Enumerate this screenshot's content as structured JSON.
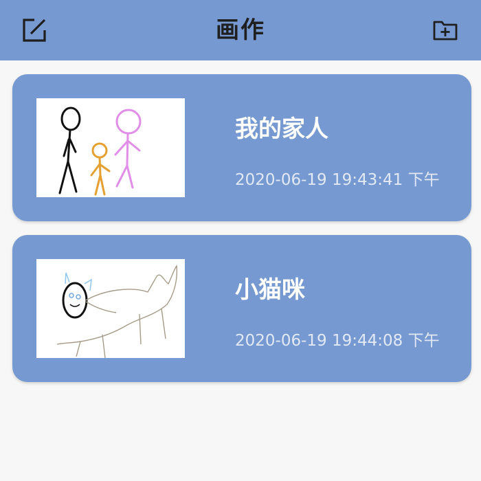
{
  "header": {
    "title": "画作",
    "left_icon": "edit-icon",
    "right_icon": "add-folder-icon"
  },
  "drawings": [
    {
      "title": "我的家人",
      "timestamp": "2020-06-19 19:43:41 下午",
      "thumbnail": "family-stick-figures"
    },
    {
      "title": "小猫咪",
      "timestamp": "2020-06-19 19:44:08 下午",
      "thumbnail": "cat-sketch"
    }
  ],
  "colors": {
    "header_bg": "#7599d0",
    "card_bg": "#7599d0",
    "page_bg": "#f7f7f7",
    "title_text": "#ffffff",
    "time_text": "#e2e9f5"
  }
}
